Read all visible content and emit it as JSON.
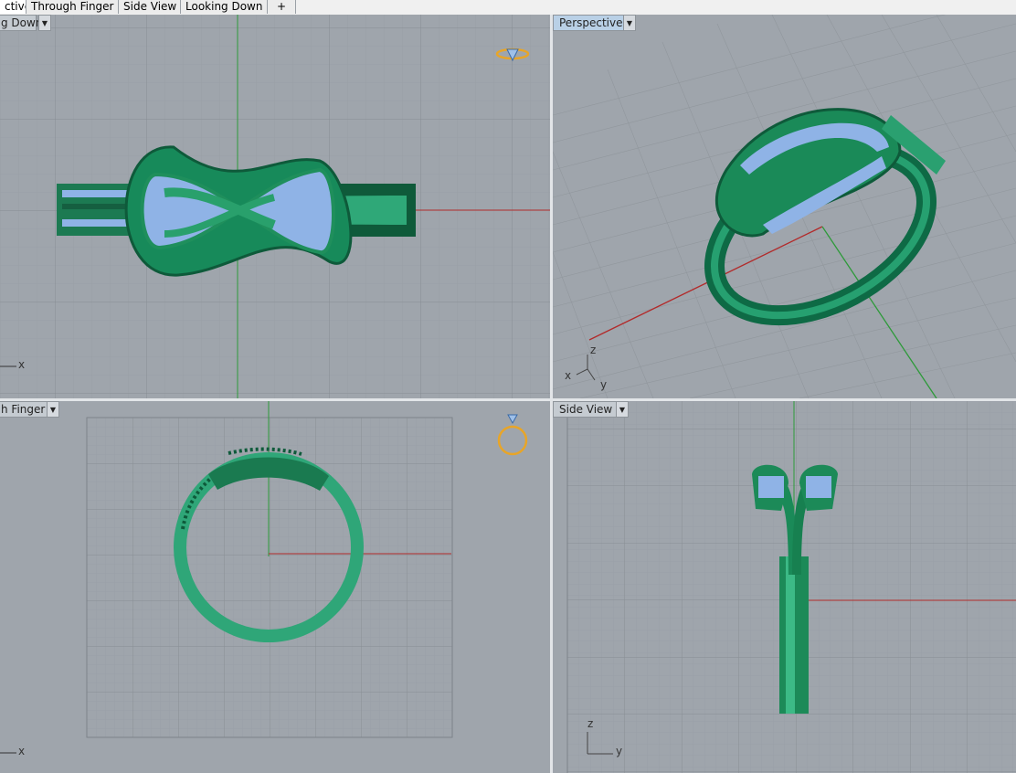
{
  "tabs": [
    {
      "label": "ctive",
      "active": true
    },
    {
      "label": "Through Finger",
      "active": false
    },
    {
      "label": "Side View",
      "active": false
    },
    {
      "label": "Looking Down",
      "active": false
    },
    {
      "label": "+",
      "active": false
    }
  ],
  "viewports": {
    "top_left": {
      "title": "g Down",
      "axis_x": "x"
    },
    "top_right": {
      "title": "Perspective",
      "axis_x": "x",
      "axis_y": "y",
      "axis_z": "z"
    },
    "bottom_left": {
      "title": "h Finger",
      "axis_x": "x"
    },
    "bottom_right": {
      "title": "Side View",
      "axis_y": "y",
      "axis_z": "z"
    }
  },
  "colors": {
    "viewport_bg": "#9fa5ac",
    "grid": "#8e949a",
    "axis_x": "#b22a2a",
    "axis_y": "#2e9a3a",
    "ring_green": "#1f8f5c",
    "stone_blue": "#8fb3e6",
    "active_title": "#b9d0e6"
  },
  "icons": [
    "caret-down-icon",
    "ring-diamond-icon",
    "ring-profile-icon",
    "add-tab-icon"
  ]
}
